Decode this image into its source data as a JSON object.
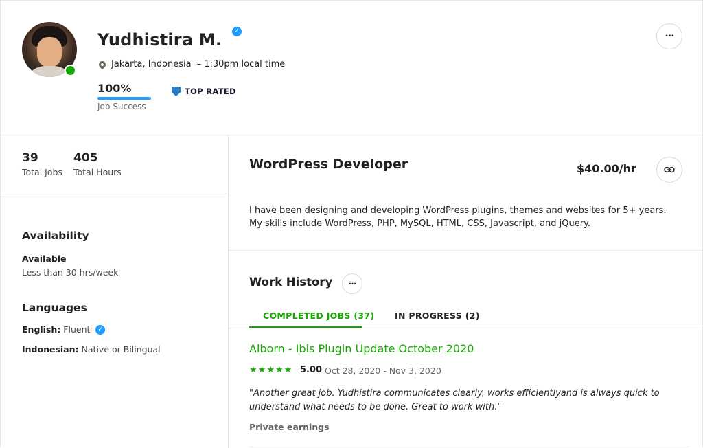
{
  "profile": {
    "name": "Yudhistira M.",
    "location": "Jakarta, Indonesia",
    "local_time": "– 1:30pm local time",
    "job_success_value": "100%",
    "job_success_fraction": 1.0,
    "job_success_label": "Job Success",
    "badge": "TOP RATED",
    "more_label": "•••"
  },
  "stats": {
    "total_jobs_value": "39",
    "total_jobs_label": "Total Jobs",
    "total_hours_value": "405",
    "total_hours_label": "Total Hours"
  },
  "sidebar": {
    "availability_heading": "Availability",
    "availability_status": "Available",
    "availability_hours": "Less than 30 hrs/week",
    "languages_heading": "Languages",
    "languages": [
      {
        "name": "English:",
        "level": "Fluent"
      },
      {
        "name": "Indonesian:",
        "level": "Native or Bilingual"
      }
    ]
  },
  "main": {
    "title": "WordPress Developer",
    "rate": "$40.00/hr",
    "description": "I have been designing and developing WordPress plugins, themes and websites for 5+ years. My skills include WordPress, PHP, MySQL, HTML, CSS, Javascript, and jQuery."
  },
  "work_history": {
    "heading": "Work History",
    "more_label": "•••",
    "tabs": [
      {
        "label": "COMPLETED JOBS (37)",
        "active": true
      },
      {
        "label": "IN PROGRESS (2)",
        "active": false
      }
    ],
    "jobs": [
      {
        "title": "Alborn - Ibis Plugin Update October 2020",
        "rating": "5.00",
        "stars": 5,
        "dates": "Oct 28, 2020 - Nov 3, 2020",
        "feedback": "\"Another great job. Yudhistira communicates clearly, works efficientlyand is always quick to understand what needs to be done. Great to work with.\"",
        "earnings": "Private earnings"
      }
    ]
  },
  "colors": {
    "accent_green": "#14a800",
    "verified_blue": "#1f9cff",
    "progress_blue": "#1f9cff",
    "border": "#e4e5e7"
  },
  "icons": {
    "verified": "verified-check-icon",
    "location": "map-pin-icon",
    "top_rated": "shield-badge-icon",
    "link": "link-icon",
    "star": "star-icon"
  }
}
